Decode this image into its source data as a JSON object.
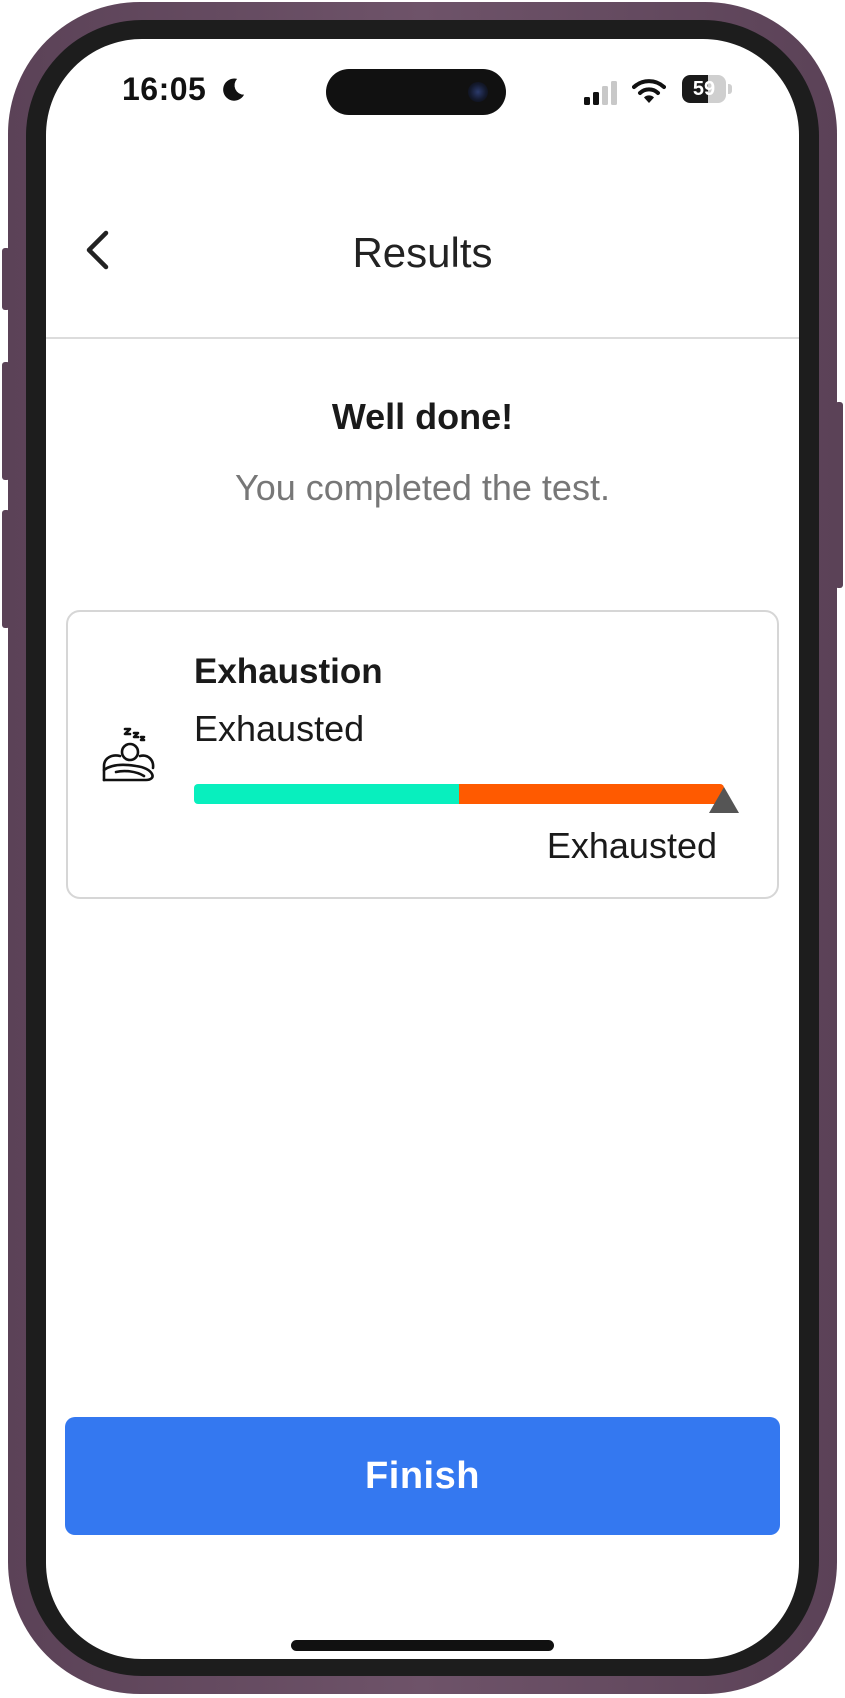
{
  "status_bar": {
    "time": "16:05",
    "battery": "59",
    "battery_level": 59,
    "icons": [
      "moon-icon",
      "signal-icon",
      "wifi-icon",
      "battery-icon"
    ]
  },
  "header": {
    "title": "Results",
    "back_icon": "chevron-left-icon"
  },
  "summary": {
    "heading": "Well done!",
    "subheading": "You completed the test."
  },
  "result_card": {
    "icon": "sleeping-person-icon",
    "title": "Exhaustion",
    "value": "Exhausted",
    "scale": {
      "segments": [
        {
          "color": "#08efbe",
          "fraction": 0.5
        },
        {
          "color": "#ff5a00",
          "fraction": 0.5
        }
      ],
      "marker_fraction": 1.0,
      "marker_label": "Exhausted"
    }
  },
  "footer": {
    "finish_label": "Finish"
  },
  "colors": {
    "accent": "#3478f0",
    "scale_green": "#08efbe",
    "scale_orange": "#ff5a00",
    "phone_frame": "#5b4257"
  }
}
